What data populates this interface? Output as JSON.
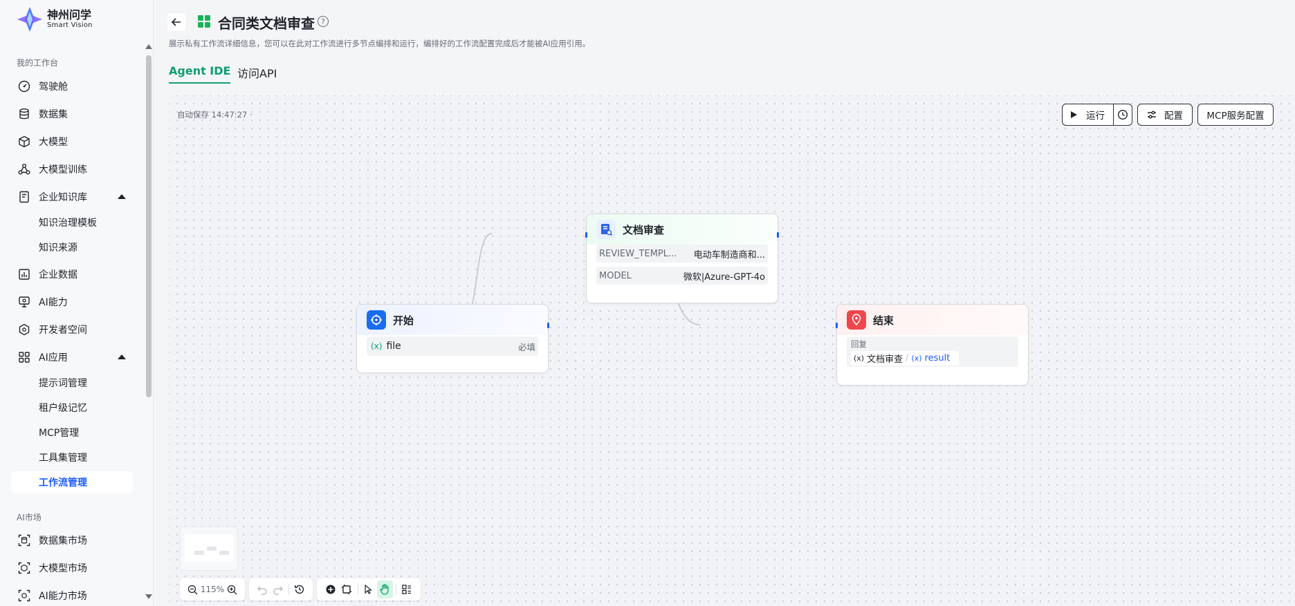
{
  "brand": {
    "name_cn": "神州问学",
    "name_en": "Smart Vision"
  },
  "sidebar": {
    "section_workbench": "我的工作台",
    "items": [
      {
        "label": "驾驶舱",
        "icon": "dashboard-icon"
      },
      {
        "label": "数据集",
        "icon": "database-icon"
      },
      {
        "label": "大模型",
        "icon": "cube-icon"
      },
      {
        "label": "大模型训练",
        "icon": "training-icon"
      },
      {
        "label": "企业知识库",
        "icon": "knowledge-icon",
        "expanded": true
      },
      {
        "label": "企业数据",
        "icon": "chart-icon"
      },
      {
        "label": "AI能力",
        "icon": "ai-monitor-icon"
      },
      {
        "label": "开发者空间",
        "icon": "developer-icon"
      },
      {
        "label": "AI应用",
        "icon": "apps-grid-icon",
        "expanded": true
      }
    ],
    "knowledge_sub": [
      "知识治理模板",
      "知识来源"
    ],
    "app_sub": [
      "提示词管理",
      "租户级记忆",
      "MCP管理",
      "工具集管理",
      "工作流管理"
    ],
    "active_sub": "工作流管理",
    "section_market": "AI市场",
    "market_items": [
      {
        "label": "数据集市场",
        "icon": "dataset-market-icon"
      },
      {
        "label": "大模型市场",
        "icon": "model-market-icon"
      },
      {
        "label": "AI能力市场",
        "icon": "ai-market-icon"
      }
    ]
  },
  "header": {
    "title": "合同类文档审查",
    "description": "展示私有工作流详细信息，您可以在此对工作流进行多节点编排和运行，编排好的工作流配置完成后才能被AI应用引用。"
  },
  "tabs": [
    {
      "label": "Agent IDE",
      "active": true
    },
    {
      "label": "访问API",
      "active": false
    }
  ],
  "toolbar": {
    "autosave": "自动保存 14:47:27 ·",
    "run": "运行",
    "config": "配置",
    "mcp": "MCP服务配置"
  },
  "nodes": {
    "start": {
      "title": "开始",
      "param_name": "file",
      "param_badge": "必填",
      "var_symbol": "(x)"
    },
    "review": {
      "title": "文档审查",
      "rows": [
        {
          "key": "REVIEW_TEMPL...",
          "value": "电动车制造商和..."
        },
        {
          "key": "MODEL",
          "value": "微软|Azure-GPT-4o"
        }
      ]
    },
    "end": {
      "title": "结束",
      "reply_label": "回复",
      "var_symbol": "(x)",
      "ref_node": "文档审查",
      "ref_sep": "/",
      "ref_var": "result"
    }
  },
  "controls": {
    "zoom": "115%"
  },
  "colors": {
    "accent_green": "#0f9f6e",
    "accent_blue": "#1a5cff",
    "start_icon": "#1a6cf0",
    "review_icon_bg": "#e8efff",
    "end_icon": "#f0474d"
  }
}
